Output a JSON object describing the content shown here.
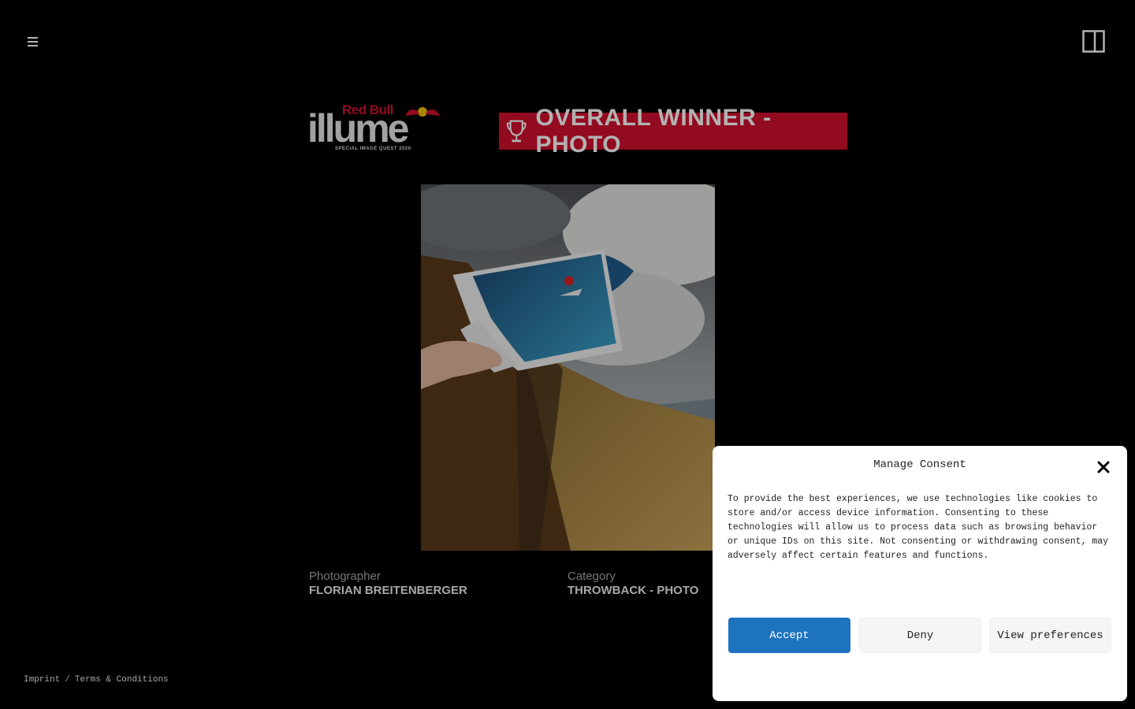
{
  "header": {
    "menu_icon": "hamburger-menu-icon",
    "panel_icon": "split-panel-icon"
  },
  "logo": {
    "brand": "Red Bull",
    "name": "illume",
    "tagline": "SPECIAL IMAGE QUEST 2020"
  },
  "banner": {
    "label": "OVERALL WINNER - PHOTO",
    "icon": "trophy-icon",
    "color": "#d2102f"
  },
  "entry": {
    "photographer_label": "Photographer",
    "photographer": "FLORIAN BREITENBERGER",
    "category_label": "Category",
    "category": "THROWBACK - PHOTO"
  },
  "footer": {
    "imprint": "Imprint",
    "separator": "/",
    "terms": "Terms & Conditions"
  },
  "consent": {
    "title": "Manage Consent",
    "body": "To provide the best experiences, we use technologies like cookies to store and/or access device information. Consenting to these technologies will allow us to process data such as browsing behavior or unique IDs on this site. Not consenting or withdrawing consent, may adversely affect certain features and functions.",
    "accept": "Accept",
    "deny": "Deny",
    "preferences": "View preferences",
    "accent": "#1e73be"
  }
}
